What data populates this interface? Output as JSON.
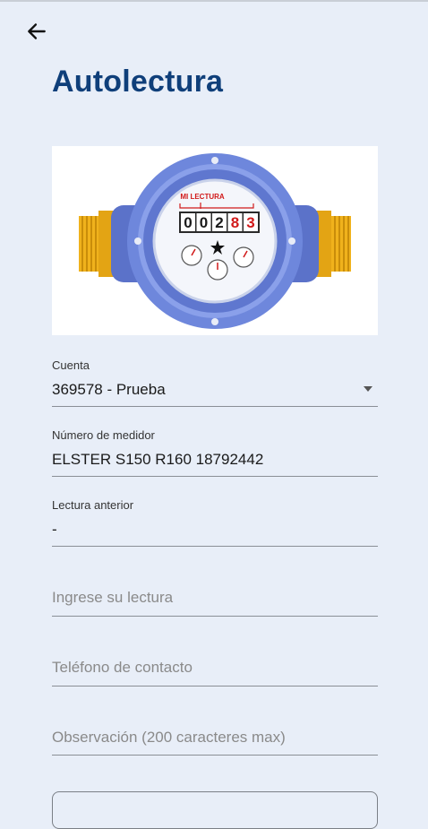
{
  "header": {
    "title": "Autolectura"
  },
  "meter_image": {
    "label": "MI LECTURA",
    "digits": [
      "0",
      "0",
      "2",
      "8",
      "3"
    ],
    "digit_colors": [
      "#1a1a1a",
      "#1a1a1a",
      "#1a1a1a",
      "#d11a1a",
      "#d11a1a"
    ]
  },
  "form": {
    "cuenta": {
      "label": "Cuenta",
      "value": "369578 - Prueba"
    },
    "medidor": {
      "label": "Número de medidor",
      "value": "ELSTER S150 R160 18792442"
    },
    "lectura_anterior": {
      "label": "Lectura anterior",
      "value": "-"
    },
    "lectura": {
      "placeholder": "Ingrese su lectura"
    },
    "telefono": {
      "placeholder": "Teléfono de contacto"
    },
    "observacion": {
      "placeholder": "Observación (200 caracteres max)"
    }
  },
  "colors": {
    "background": "#e8eef8",
    "title": "#0f3f7a",
    "meter_body": "#6f86d8",
    "brass": "#f2b81a"
  }
}
